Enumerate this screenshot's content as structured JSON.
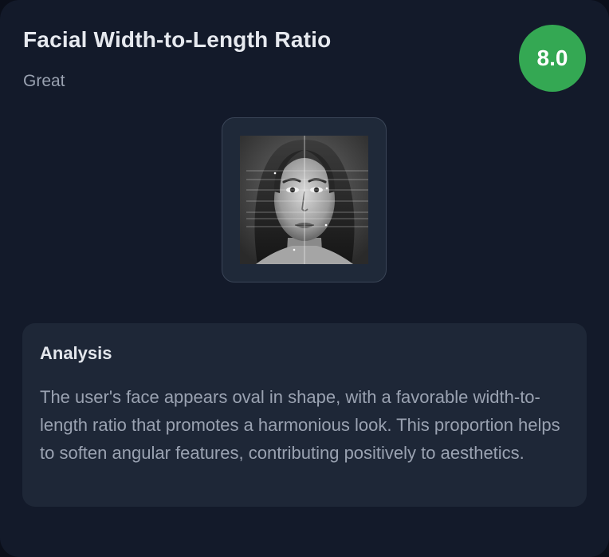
{
  "metric": {
    "title": "Facial Width-to-Length Ratio",
    "rating": "Great",
    "score": "8.0",
    "score_color": "#34a853"
  },
  "image": {
    "subject": "face-portrait-with-proportion-guides"
  },
  "analysis": {
    "heading": "Analysis",
    "text": "The user's face appears oval in shape, with a favorable width-to-length ratio that promotes a harmonious look. This proportion helps to soften angular features, contributing positively to aesthetics."
  },
  "colors": {
    "card_background": "#131a2a",
    "panel_background": "#1e2737",
    "text_primary": "#e6e9ef",
    "text_secondary": "#9aa2b1"
  }
}
